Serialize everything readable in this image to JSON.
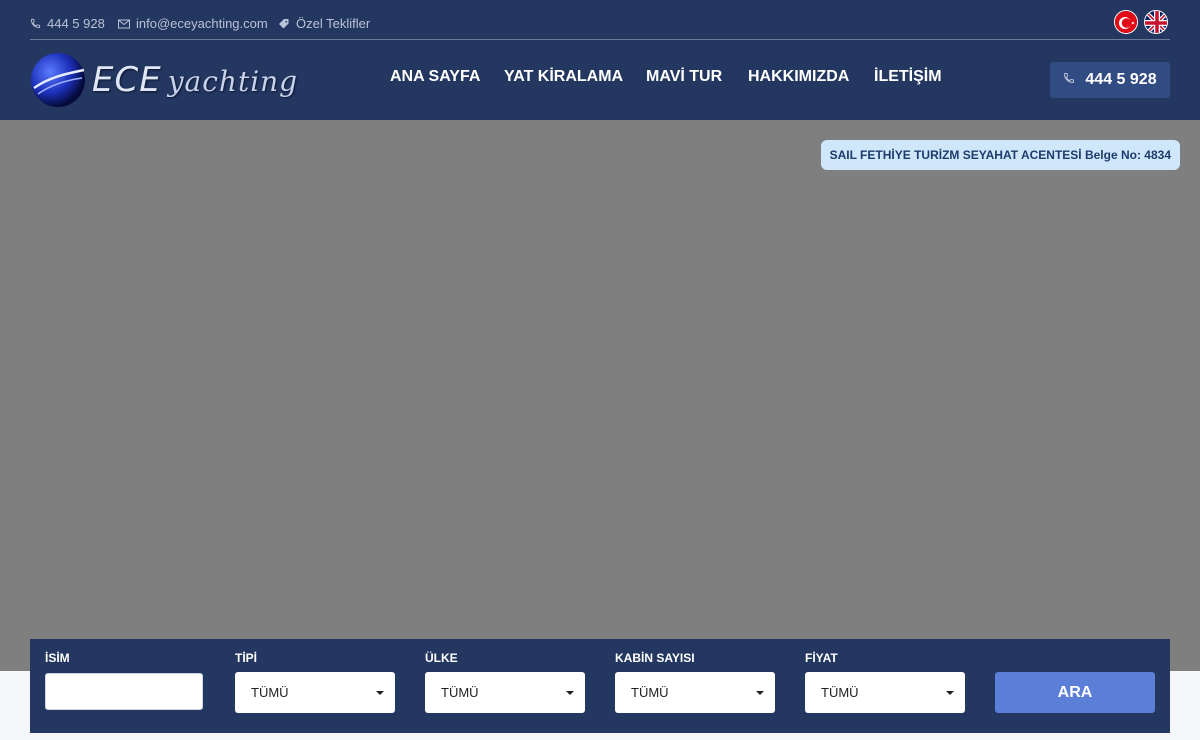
{
  "topbar": {
    "phone": "444 5 928",
    "email": "info@eceyachting.com",
    "offers": "Özel Teklifler",
    "languages": [
      "tr-flag",
      "en-flag"
    ]
  },
  "logo": {
    "main": "ECE",
    "sub": "yachting"
  },
  "nav": {
    "items": [
      "ANA SAYFA",
      "YAT KİRALAMA",
      "MAVİ TUR",
      "HAKKIMIZDA",
      "İLETİŞİM"
    ]
  },
  "header_phone": "444 5 928",
  "license_badge": "SAIL FETHİYE TURİZM SEYAHAT ACENTESİ Belge No: 4834",
  "search": {
    "name_label": "İSİM",
    "name_value": "",
    "type_label": "TİPİ",
    "type_value": "TÜMÜ",
    "country_label": "ÜLKE",
    "country_value": "TÜMÜ",
    "cabins_label": "KABİN SAYISI",
    "cabins_value": "TÜMÜ",
    "price_label": "FİYAT",
    "price_value": "TÜMÜ",
    "submit_label": "ARA"
  },
  "colors": {
    "header_bg": "#243760",
    "hero_bg": "#7f7f7f",
    "badge_bg": "#cfe6fb",
    "accent_button": "#5b7fd6"
  }
}
